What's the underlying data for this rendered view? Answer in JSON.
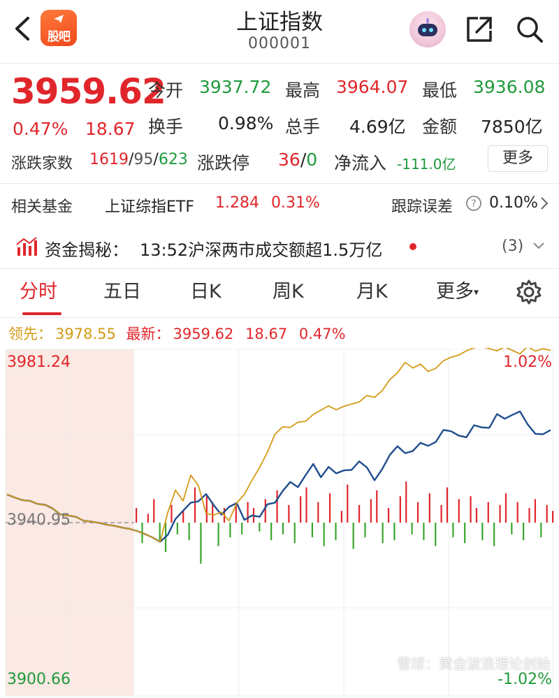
{
  "header": {
    "title": "上证指数",
    "code": "000001",
    "logo_text": "股吧"
  },
  "quote": {
    "price": "3959.62",
    "change_pct": "0.47%",
    "change_abs": "18.67",
    "open_label": "今开",
    "open": "3937.72",
    "high_label": "最高",
    "high": "3964.07",
    "low_label": "最低",
    "low": "3936.08",
    "turnover_label": "换手",
    "turnover": "0.98%",
    "volume_label": "总手",
    "volume": "4.69亿",
    "amount_label": "金额",
    "amount": "7850亿",
    "breadth_label": "涨跌家数",
    "breadth_up": "1619",
    "breadth_sep1": "/",
    "breadth_flat": "95",
    "breadth_sep2": "/",
    "breadth_down": "623",
    "limit_label": "涨跌停",
    "limit_up": "36",
    "limit_sep": "/",
    "limit_down": "0",
    "netflow_label": "净流入",
    "netflow": "-111.0亿",
    "more_label": "更多"
  },
  "fund": {
    "label": "相关基金",
    "name": "上证综指ETF",
    "price": "1.284",
    "change": "0.31%",
    "tracking_label": "跟踪误差",
    "tracking_value": "0.10%"
  },
  "news": {
    "label": "资金揭秘：",
    "headline": "13:52沪深两市成交额超1.5万亿",
    "count": "(3)"
  },
  "tabs": [
    {
      "label": "分时"
    },
    {
      "label": "五日"
    },
    {
      "label": "日K"
    },
    {
      "label": "周K"
    },
    {
      "label": "月K"
    },
    {
      "label": "更多"
    }
  ],
  "lead_line": {
    "lead_label": "领先：",
    "lead_value": "3978.55",
    "latest_label": "最新：",
    "latest_value": "3959.62",
    "change_abs": "18.67",
    "change_pct": "0.47%"
  },
  "chart_data": {
    "type": "line",
    "y_top_label": "3981.24",
    "y_mid_label": "3940.95",
    "y_bottom_label": "3900.66",
    "pct_top_label": "1.02%",
    "pct_bottom_label": "-1.02%",
    "ylim": [
      3900.66,
      3981.24
    ],
    "prev_close": 3940.95,
    "series": [
      {
        "values": [
          3947.5,
          3946.8,
          3946.2,
          3946.0,
          3945.3,
          3945.1,
          3944.2,
          3942.8,
          3942.6,
          3942.3,
          3941.4,
          3941.2,
          3940.9,
          3940.5,
          3940.2,
          3939.8,
          3939.5,
          3939.0,
          3938.3,
          3937.5,
          3936.5,
          3938.1,
          3941.8,
          3943.7,
          3945.6,
          3945.9,
          3947.6,
          3945.0,
          3942.8,
          3944.6,
          3945.5,
          3941.6,
          3942.6,
          3942.3,
          3945.2,
          3945.6,
          3948.3,
          3950.4,
          3949.2,
          3952.0,
          3954.6,
          3951.5,
          3953.9,
          3952.4,
          3953.1,
          3953.2,
          3955.2,
          3953.8,
          3950.8,
          3953.4,
          3956.7,
          3958.7,
          3957.1,
          3957.6,
          3959.5,
          3958.8,
          3959.7,
          3962.5,
          3962.2,
          3961.2,
          3960.8,
          3963.6,
          3963.1,
          3963.0,
          3966.2,
          3965.1,
          3966.0,
          3966.8,
          3963.8,
          3961.6,
          3961.5,
          3962.5
        ]
      },
      {
        "values": [
          3947.5,
          3946.8,
          3946.2,
          3946.0,
          3945.3,
          3945.1,
          3944.2,
          3942.8,
          3942.6,
          3942.3,
          3941.4,
          3941.2,
          3940.9,
          3940.5,
          3940.2,
          3939.8,
          3939.5,
          3939.0,
          3938.3,
          3937.5,
          3936.5,
          3943.3,
          3948.5,
          3946.0,
          3952.0,
          3949.6,
          3943.1,
          3942.7,
          3943.4,
          3941.4,
          3945.5,
          3947.5,
          3950.8,
          3953.8,
          3957.3,
          3961.5,
          3963.2,
          3963.1,
          3964.3,
          3964.5,
          3966.1,
          3967.1,
          3968.1,
          3967.2,
          3968.0,
          3968.5,
          3969.0,
          3970.5,
          3970.1,
          3971.6,
          3974.2,
          3975.8,
          3978.2,
          3976.9,
          3977.8,
          3976.1,
          3976.8,
          3978.6,
          3979.4,
          3979.9,
          3980.9,
          3981.6,
          3981.9,
          3981.4,
          3980.9,
          3981.8,
          3981.0,
          3980.2,
          3981.9,
          3980.8,
          3981.4,
          3981.0
        ]
      }
    ],
    "volume_bars": [
      5,
      -7,
      3,
      8,
      -6,
      -10,
      6,
      -4,
      4,
      -6,
      12,
      -14,
      9,
      7,
      -8,
      5,
      -5,
      6,
      -4,
      7,
      5,
      -3,
      8,
      -6,
      11,
      -4,
      6,
      -7,
      9,
      12,
      -5,
      7,
      -8,
      10,
      -6,
      4,
      13,
      -9,
      6,
      -5,
      8,
      11,
      -7,
      5,
      -6,
      9,
      14,
      -4,
      7,
      -6,
      10,
      -8,
      6,
      12,
      -5,
      8,
      -7,
      9,
      5,
      -6,
      7,
      -8,
      6,
      10,
      -4,
      7,
      -6,
      5,
      8,
      -5,
      6,
      4
    ]
  },
  "watermark": "雪球：黄金波浪理论创始"
}
